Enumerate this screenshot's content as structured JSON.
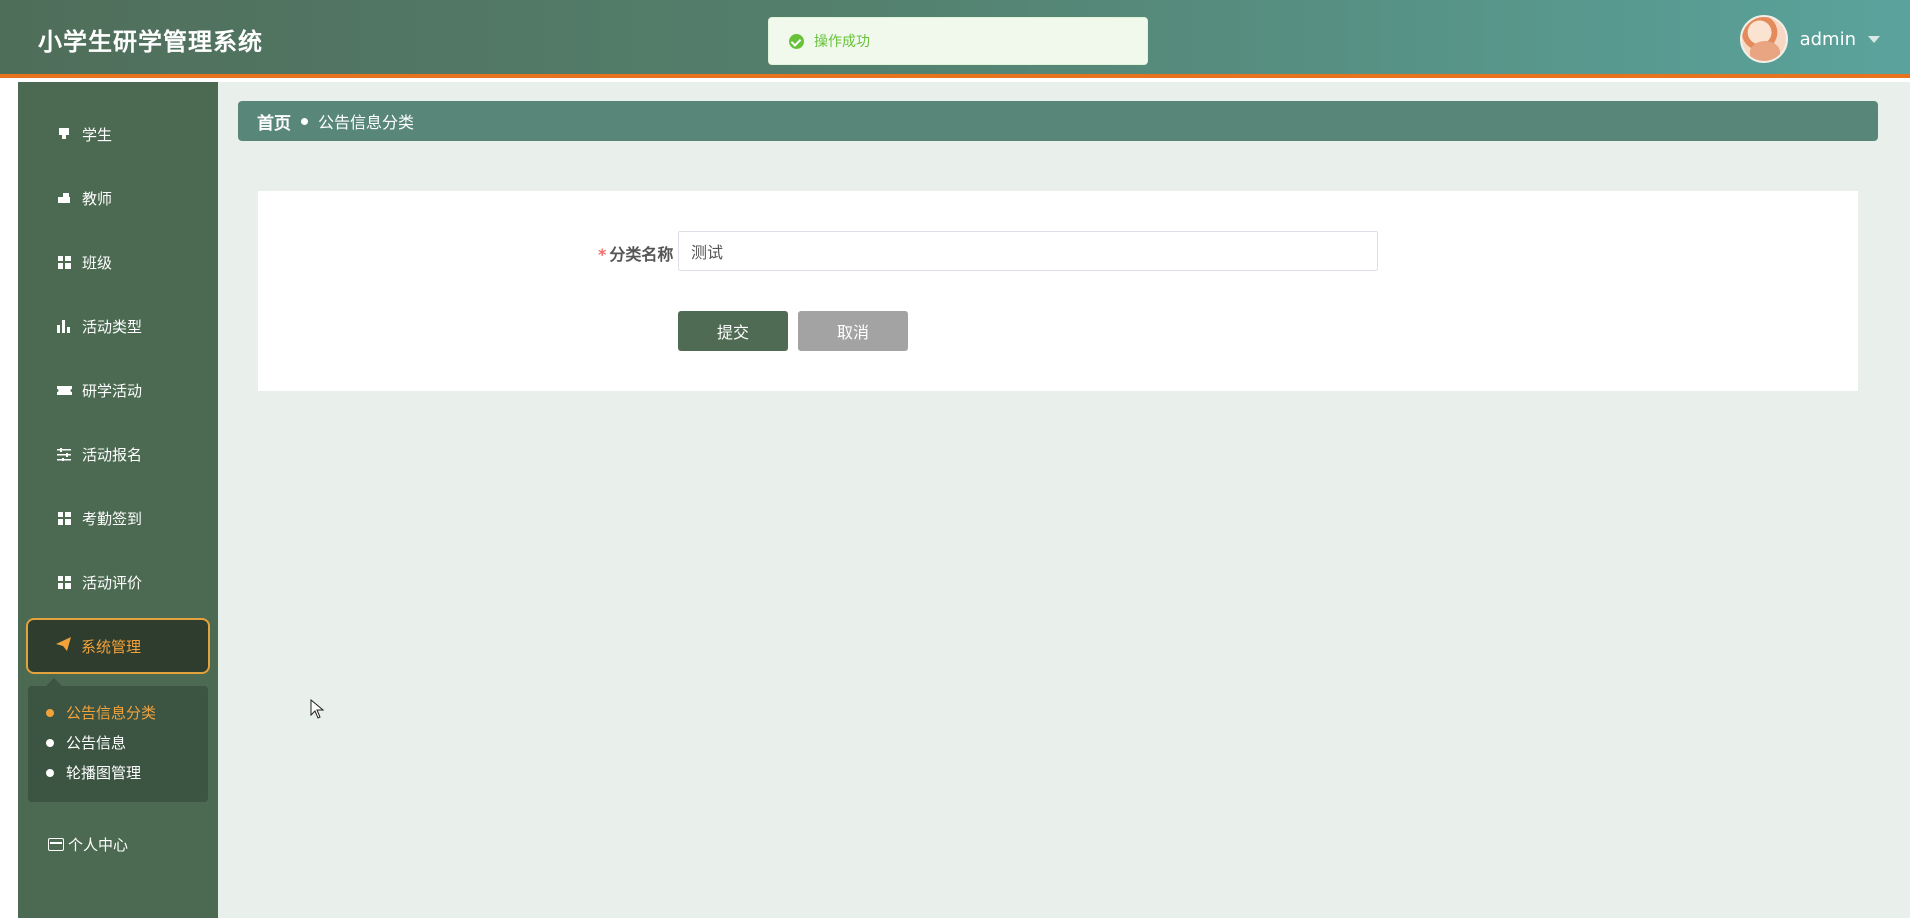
{
  "header": {
    "title": "小学生研学管理系统",
    "username": "admin"
  },
  "toast": {
    "message": "操作成功",
    "status": "success",
    "color": "#67c23a"
  },
  "sidebar": {
    "items": [
      {
        "label": "学生",
        "icon": "student-icon"
      },
      {
        "label": "教师",
        "icon": "teacher-icon"
      },
      {
        "label": "班级",
        "icon": "grid-icon"
      },
      {
        "label": "活动类型",
        "icon": "bar-chart-icon"
      },
      {
        "label": "研学活动",
        "icon": "ticket-icon"
      },
      {
        "label": "活动报名",
        "icon": "sliders-icon"
      },
      {
        "label": "考勤签到",
        "icon": "grid-icon"
      },
      {
        "label": "活动评价",
        "icon": "grid-icon"
      }
    ],
    "active": {
      "label": "系统管理",
      "icon": "send-icon"
    },
    "submenu": [
      {
        "label": "公告信息分类",
        "selected": true
      },
      {
        "label": "公告信息",
        "selected": false
      },
      {
        "label": "轮播图管理",
        "selected": false
      }
    ],
    "profile": {
      "label": "个人中心",
      "icon": "wallet-icon"
    }
  },
  "breadcrumb": {
    "home": "首页",
    "current": "公告信息分类"
  },
  "form": {
    "field_label": "分类名称",
    "required_mark": "*",
    "field_value": "测试",
    "submit_label": "提交",
    "cancel_label": "取消"
  },
  "colors": {
    "header_accent": "#e8731e",
    "sidebar_bg": "#4b6a51",
    "active_accent": "#f2a23b",
    "breadcrumb_bg": "#58877a"
  }
}
